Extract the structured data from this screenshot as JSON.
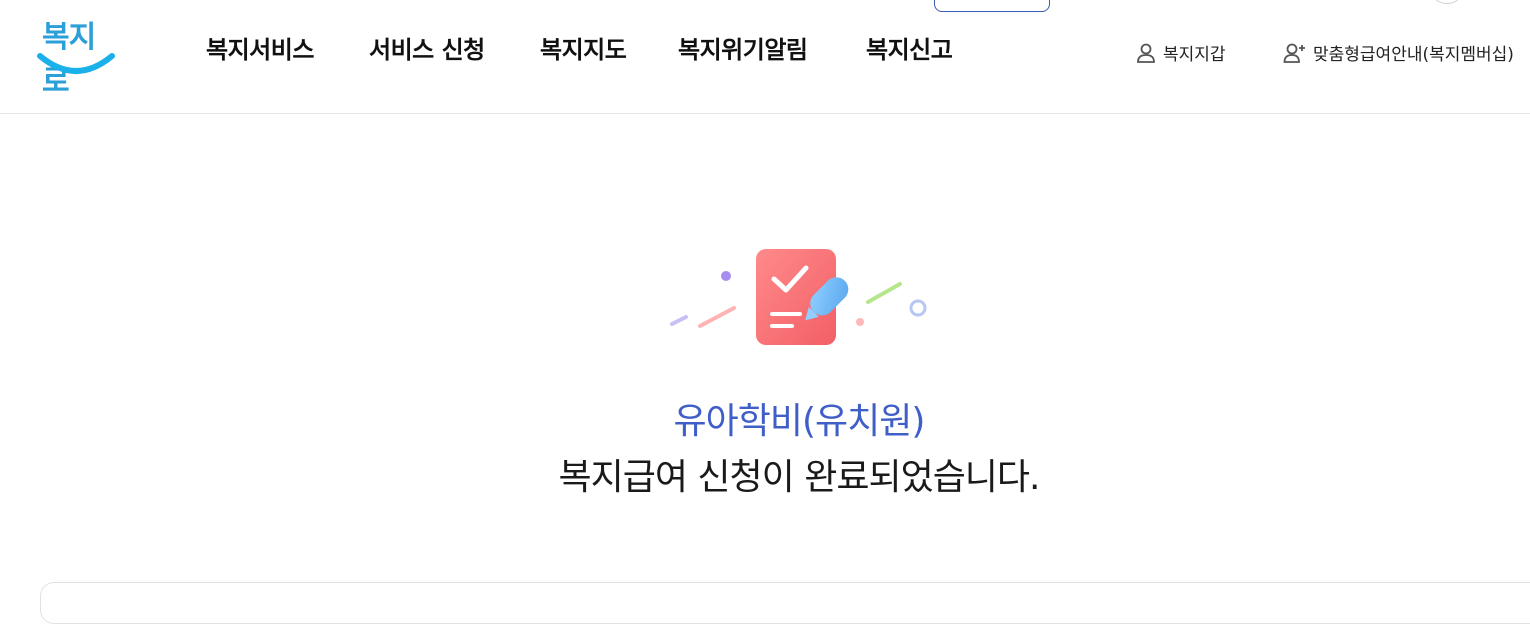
{
  "header": {
    "logo_text": "복지로",
    "nav": [
      {
        "label": "복지서비스"
      },
      {
        "label": "서비스 신청"
      },
      {
        "label": "복지지도"
      },
      {
        "label": "복지위기알림"
      },
      {
        "label": "복지신고"
      }
    ],
    "utility": [
      {
        "label": "복지지갑",
        "icon": "user-icon"
      },
      {
        "label": "맞춤형급여안내(복지멤버십)",
        "icon": "user-add-icon"
      }
    ]
  },
  "main": {
    "service_name": "유아학비(유치원)",
    "complete_message": "복지급여 신청이 완료되었습니다."
  },
  "colors": {
    "brand_blue": "#3f5ec7",
    "logo_blue": "#2a9fd8",
    "icon_red": "#f46b6b",
    "pen_blue": "#6fb9f4"
  }
}
